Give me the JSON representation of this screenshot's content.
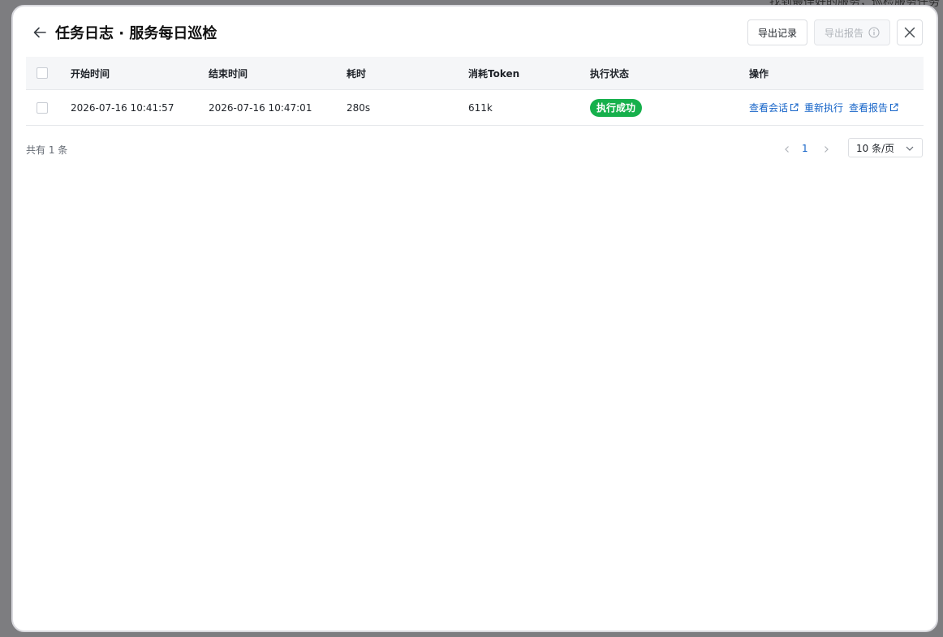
{
  "backdrop": {
    "text": "找到最佳好的服务，巡检服务任务"
  },
  "header": {
    "title": "任务日志 · 服务每日巡检",
    "export_records_label": "导出记录",
    "export_report_label": "导出报告"
  },
  "table": {
    "columns": [
      "开始时间",
      "结束时间",
      "耗时",
      "消耗Token",
      "执行状态",
      "操作"
    ],
    "rows": [
      {
        "start": "2026-07-16 10:41:57",
        "end": "2026-07-16 10:47:01",
        "duration": "280s",
        "tokens": "611k",
        "status": "执行成功",
        "actions": [
          "查看会话",
          "重新执行",
          "查看报告"
        ]
      }
    ]
  },
  "footer": {
    "total": "共有 1 条",
    "current_page": "1",
    "page_size": "10 条/页"
  },
  "colors": {
    "success": "#16b04c",
    "link": "#1664c8"
  },
  "icons": [
    "arrow-left-icon",
    "info-icon",
    "close-icon",
    "external-link-icon",
    "chevron-left-icon",
    "chevron-right-icon",
    "chevron-down-icon"
  ]
}
